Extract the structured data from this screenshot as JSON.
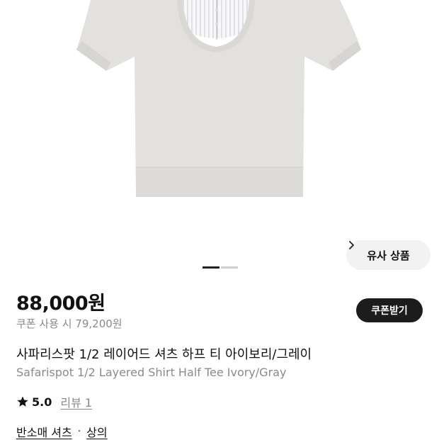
{
  "product": {
    "price": "88,000원",
    "coupon_price_text": "쿠폰 사용 시 79,200원",
    "coupon_button_label": "쿠폰받기",
    "title_ko": "사파리스팟 1/2 레이어드 셔츠 하프 티 아이보리/그레이",
    "title_en": "Safarispot 1/2 Layered Shirt Half Tee Ivory/Gray",
    "rating": "5.0",
    "review_text": "리뷰 1"
  },
  "image": {
    "similar_button_label": "유사 상품",
    "carousel": {
      "total": 2,
      "active": 1
    },
    "colors": {
      "tee": "#e2e1de",
      "tee_shadow": "#d6d5d1",
      "shirt": "#f7f7f9",
      "pleat": "#c9cad0"
    }
  },
  "categories": {
    "items": [
      "반소매 셔츠",
      "상의"
    ],
    "separator": "·"
  },
  "icons": {
    "rating": "star-icon",
    "similar": "chevron-right-icon"
  }
}
